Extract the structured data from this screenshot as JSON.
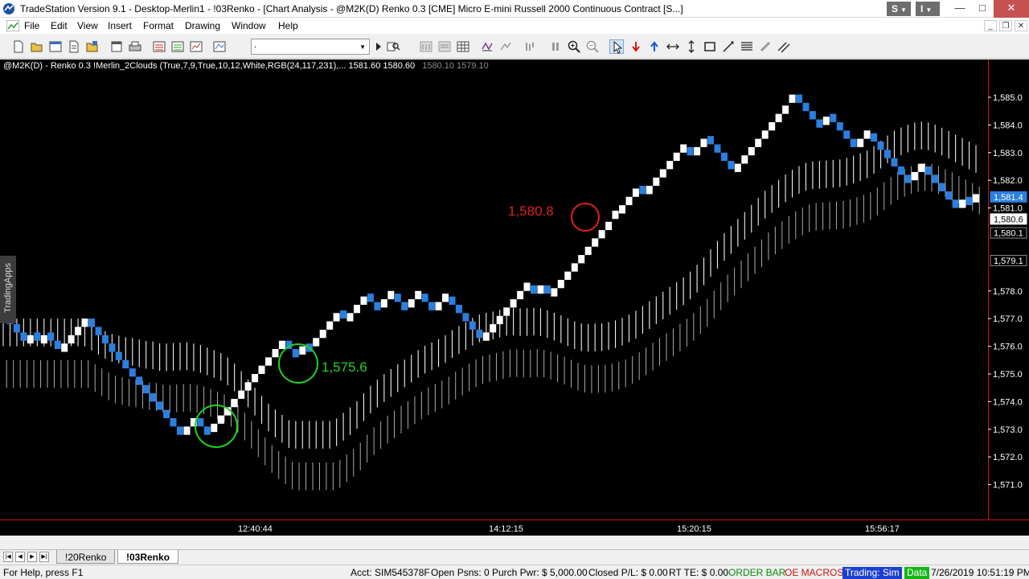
{
  "window": {
    "title": "TradeStation Version 9.1 - Desktop-Merlin1 - !03Renko - [Chart Analysis - @M2K(D) Renko 0.3 [CME] Micro E-mini Russell 2000 Continuous Contract [S...]",
    "s_menu": "S",
    "i_menu": "I",
    "minimize": "—",
    "maximize": "□",
    "close": "✕"
  },
  "menu": {
    "items": [
      "File",
      "Edit",
      "View",
      "Insert",
      "Format",
      "Drawing",
      "Window",
      "Help"
    ],
    "mdi_min": "_",
    "mdi_restore": "❐",
    "mdi_close": "✕"
  },
  "toolbar": {
    "symbol_value": ".",
    "icons": [
      "new-icon",
      "open-icon",
      "new-window-icon",
      "workspace-icon",
      "print-preview-icon",
      "print-icon",
      "format-icon",
      "insert-icon",
      "analysis-icon",
      "go-icon",
      "symbol-lookup-icon",
      "bar-spacing-icon",
      "data-window-icon",
      "table-icon",
      "auto-scale-icon",
      "drag-icon",
      "pause-icon",
      "zoom-in-icon",
      "zoom-out-icon",
      "pointer-icon",
      "down-arrow-icon",
      "up-arrow-icon",
      "horizontal-line-icon",
      "vertical-line-icon",
      "rectangle-icon",
      "trendline-icon",
      "fib-icon",
      "eraser-icon",
      "channel-icon"
    ]
  },
  "chart": {
    "header_main": "@M2K(D) - Renko 0.3  !Merlin_2Clouds (True,7,9,True,10,12,White,RGB(24,117,231),...   1581.60   1580.60",
    "header_dim": "1580.10   1579.10",
    "side_tab": "TradingApps",
    "annotations": [
      {
        "text": "1,580.8",
        "color": "#e02020"
      },
      {
        "text": "1,575.6",
        "color": "#21d321"
      }
    ],
    "price_markers": [
      {
        "text": "1,581.4",
        "value": 1581.4,
        "style": "blue"
      },
      {
        "text": "1,580.6",
        "value": 1580.6,
        "style": "white"
      },
      {
        "text": "1,580.1",
        "value": 1580.1,
        "style": "gray"
      },
      {
        "text": "1,579.1",
        "value": 1579.1,
        "style": "gray"
      }
    ],
    "time_labels": [
      "12:40:44",
      "14:12:15",
      "15:20:15",
      "15:56:17"
    ]
  },
  "chart_data": {
    "type": "renko",
    "brick_size": 0.3,
    "up_color": "#ffffff",
    "down_color": "#2a7fe0",
    "y_ticks": [
      1585.0,
      1584.0,
      1583.0,
      1582.0,
      1581.0,
      1578.0,
      1577.0,
      1576.0,
      1575.0,
      1574.0,
      1573.0,
      1572.0,
      1571.0
    ],
    "y_tick_labels": [
      "1,585.0",
      "1,584.0",
      "1,583.0",
      "1,582.0",
      "1,581.0",
      "1,578.0",
      "1,577.0",
      "1,576.0",
      "1,575.0",
      "1,574.0",
      "1,573.0",
      "1,572.0",
      "1,571.0"
    ],
    "ylim": [
      1570.2,
      1585.6
    ],
    "waypoints": [
      1577.4,
      1576.1,
      1576.5,
      1576.1,
      1576.5,
      1575.8,
      1577.0,
      1574.0,
      1572.8,
      1573.4,
      1572.9,
      1575.9,
      1576.2,
      1575.7,
      1576.1,
      1576.0,
      1577.3,
      1576.9,
      1577.9,
      1577.4,
      1577.9,
      1577.4,
      1577.9,
      1577.3,
      1577.8,
      1576.2,
      1578.2,
      1577.9,
      1578.2,
      1577.8,
      1580.6,
      1580.8,
      1581.8,
      1581.5,
      1581.8,
      1583.2,
      1582.9,
      1583.6,
      1582.3,
      1584.8,
      1585.1,
      1584.0,
      1584.4,
      1583.2,
      1583.7,
      1582.0,
      1582.5,
      1581.0,
      1581.4,
      1581.2,
      1581.4
    ]
  },
  "tabs": {
    "items": [
      "!20Renko",
      "!03Renko"
    ],
    "active_index": 1
  },
  "status": {
    "help": "For Help, press F1",
    "acct": "Acct: SIM545378F",
    "open_psns": "Open Psns: 0",
    "purch_pwr": "Purch Pwr: $ 5,000.00",
    "closed_pl": "Closed P/L: $ 0.00",
    "rt_te": "RT TE: $ 0.00",
    "order_bar": "ORDER BAR",
    "oe_macros": "OE MACROS",
    "trading": "Trading: Sim",
    "data": "Data",
    "datetime": "7/26/2019 10:51:19 PM"
  }
}
